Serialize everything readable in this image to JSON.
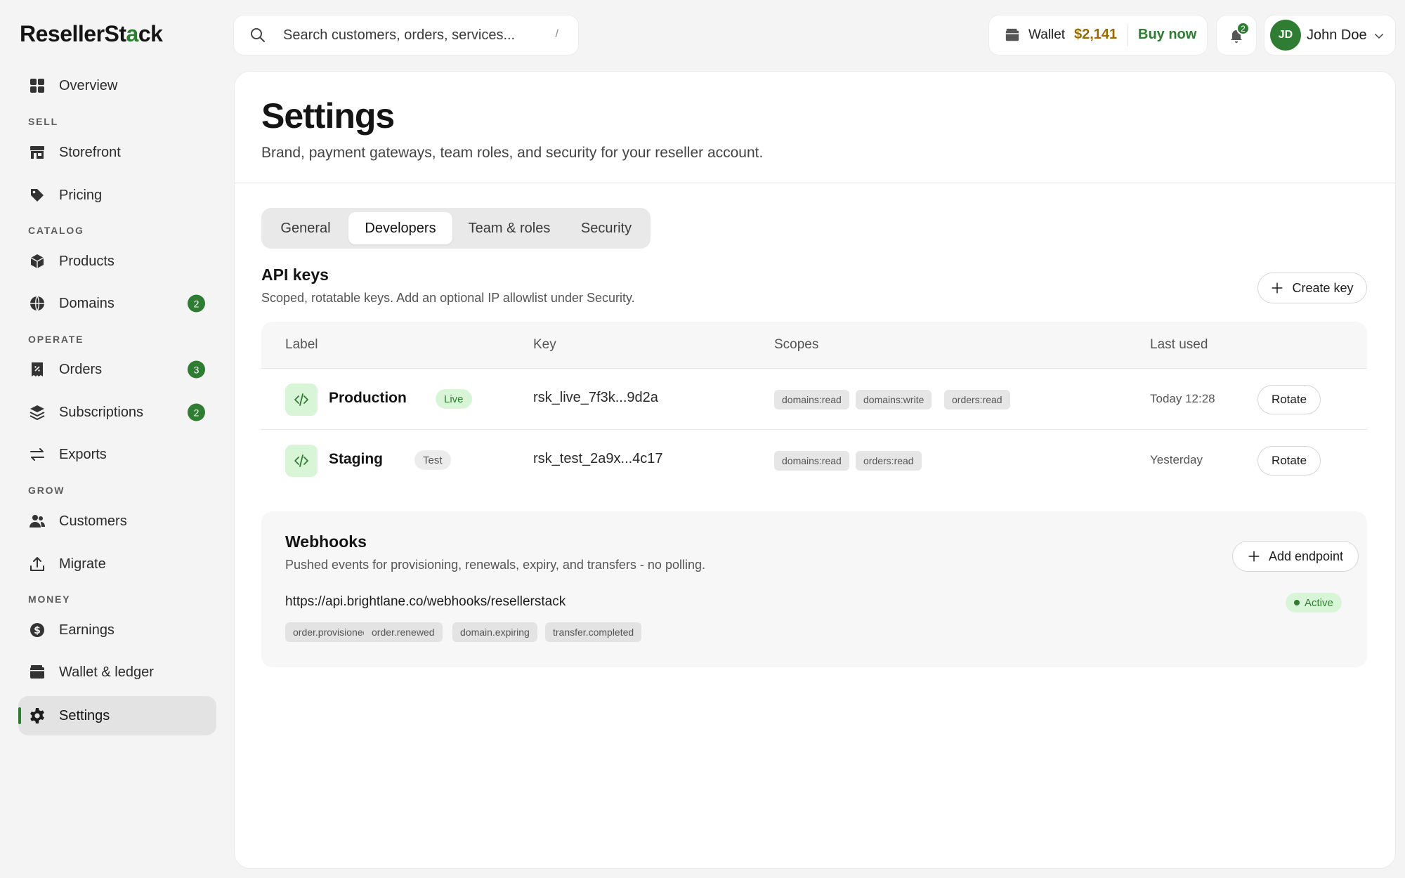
{
  "brand": {
    "logo_pre": "ResellerSt",
    "logo_accent": "a",
    "logo_post": "ck"
  },
  "sidebar": {
    "overview": "Overview",
    "sections": {
      "sell": "SELL",
      "catalog": "CATALOG",
      "operate": "OPERATE",
      "grow": "GROW",
      "money": "MONEY"
    },
    "items": {
      "storefront": "Storefront",
      "pricing": "Pricing",
      "products": "Products",
      "domains": {
        "label": "Domains",
        "badge": "2"
      },
      "orders": {
        "label": "Orders",
        "badge": "3"
      },
      "subscriptions": {
        "label": "Subscriptions",
        "badge": "2"
      },
      "exports": "Exports",
      "customers": "Customers",
      "migrate": "Migrate",
      "earnings": "Earnings",
      "wallet": "Wallet & ledger",
      "settings": "Settings"
    },
    "active": "settings"
  },
  "topbar": {
    "search_placeholder": "Search customers, orders, services...",
    "search_shortcut": "/",
    "wallet_label": "Wallet",
    "wallet_amount": "$2,141",
    "buy_now": "Buy now",
    "notifications_count": "2",
    "user_initials": "JD",
    "user_name": "John Doe"
  },
  "page": {
    "title": "Settings",
    "subtitle": "Brand, payment gateways, team roles, and security for your reseller account.",
    "tabs": [
      "General",
      "Developers",
      "Team & roles",
      "Security"
    ],
    "active_tab": "Developers"
  },
  "api_keys": {
    "title": "API keys",
    "subtitle": "Scoped, rotatable keys. Add an optional IP allowlist under Security.",
    "create_label": "Create key",
    "columns": [
      "Label",
      "Key",
      "Scopes",
      "Last used"
    ],
    "rows": [
      {
        "label": "Production",
        "env": "Live",
        "key": "rsk_live_7f3k...9d2a",
        "scopes": [
          "domains:read",
          "domains:write",
          "orders:read"
        ],
        "last_used": "Today 12:28",
        "action": "Rotate"
      },
      {
        "label": "Staging",
        "env": "Test",
        "key": "rsk_test_2a9x...4c17",
        "scopes": [
          "domains:read",
          "orders:read"
        ],
        "last_used": "Yesterday",
        "action": "Rotate"
      }
    ]
  },
  "webhooks": {
    "title": "Webhooks",
    "subtitle": "Pushed events for provisioning, renewals, expiry, and transfers - no polling.",
    "add_label": "Add endpoint",
    "url": "https://api.brightlane.co/webhooks/resellerstack",
    "status": "Active",
    "events": [
      "order.provisioned",
      "order.renewed",
      "domain.expiring",
      "transfer.completed"
    ]
  },
  "colors": {
    "accent": "#2e7d32",
    "wallet_amount": "#9a6a00",
    "pill_green_bg": "#d9f5d8"
  }
}
